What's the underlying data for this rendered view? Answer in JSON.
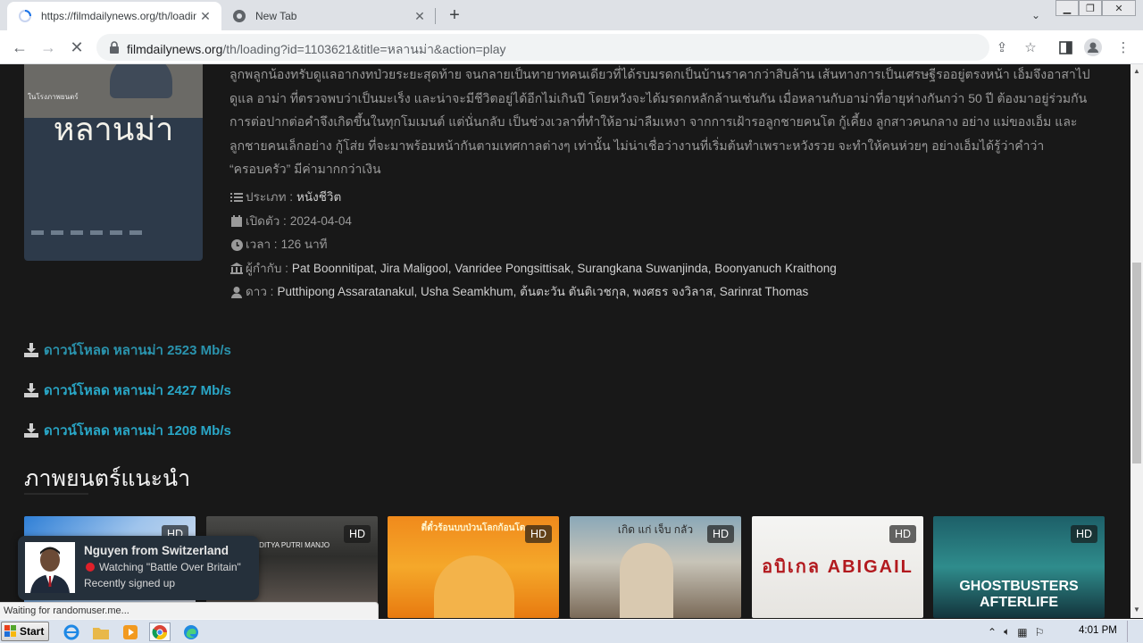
{
  "browser": {
    "tabs": [
      {
        "title": "https://filmdailynews.org/th/loading",
        "active": true,
        "loading": true
      },
      {
        "title": "New Tab",
        "active": false
      }
    ],
    "address": {
      "host": "filmdailynews.org",
      "path": "/th/loading?id=1103621&title=หลานม่า&action=play"
    },
    "status_text": "Waiting for randomuser.me..."
  },
  "movie": {
    "poster": {
      "title": "หลานม่า",
      "tagline": "ในโรงภาพยนตร์"
    },
    "synopsis": "ลูกพลูกน้องทรับดูแลอากงทป่วยระยะสุดท้าย จนกลายเป็นทายาทคนเดียวที่ได้รบมรดกเป็นบ้านราคากว่าสิบล้าน เส้นทางการเป็นเศรษฐีรออยู่ตรงหน้า เอ็มจึงอาสาไปดูแล อาม่า ที่ตรวจพบว่าเป็นมะเร็ง และน่าจะมีชีวิตอยู่ได้อีกไม่เกินปี โดยหวังจะได้มรดกหลักล้านเช่นกัน เมื่อหลานกับอาม่าที่อายุห่างกันกว่า 50 ปี ต้องมาอยู่ร่วมกัน การต่อปากต่อคำจึงเกิดขึ้นในทุกโมเมนต์ แต่นั่นกลับ เป็นช่วงเวลาที่ทำให้อาม่าลืมเหงา จากการเฝ้ารอลูกชายคนโต กู้เคี้ยง ลูกสาวคนกลาง อย่าง แม่ของเอ็ม และลูกชายคนเล็กอย่าง กู้โส่ย ที่จะมาพร้อมหน้ากันตามเทศกาลต่างๆ เท่านั้น ไม่น่าเชื่อว่างานที่เริ่มต้นทำเพราะหวังรวย จะทำให้คนห่วยๆ อย่างเอ็มได้รู้ว่าคำว่า “ครอบครัว” มีค่ามากกว่าเงิน",
    "meta": [
      {
        "icon": "list-icon",
        "label": "ประเภท :",
        "value": "หนังชีวิต"
      },
      {
        "icon": "calendar-icon",
        "label": "เปิดตัว :",
        "value": "2024-04-04"
      },
      {
        "icon": "clock-icon",
        "label": "เวลา :",
        "value": "126 นาที"
      },
      {
        "icon": "bank-icon",
        "label": "ผู้กำกับ :",
        "value": "Pat Boonnitipat, Jira Maligool, Vanridee Pongsittisak, Surangkana Suwanjinda, Boonyanuch Kraithong"
      },
      {
        "icon": "user-icon",
        "label": "ดาว :",
        "value": "Putthipong Assaratanakul, Usha Seamkhum, ต้นตะวัน ตันติเวชกุล, พงศธร จงวิลาส, Sarinrat Thomas"
      }
    ],
    "downloads": [
      {
        "label": "ดาวน์โหลด หลานม่า 2523 Mb/s"
      },
      {
        "label": "ดาวน์โหลด หลานม่า 2427 Mb/s"
      },
      {
        "label": "ดาวน์โหลด หลานม่า 1208 Mb/s"
      }
    ]
  },
  "recommended": {
    "heading": "ภาพยนตร์แนะนำ",
    "badge": "HD",
    "cards": [
      {
        "name": "movie-card-1",
        "text": ""
      },
      {
        "name": "movie-card-2",
        "text": "ADITYA  PUTRI MANJO"
      },
      {
        "name": "movie-card-3",
        "text": "ตี๋ตั๋วร้อนบบป่วนโลกก้อนโต"
      },
      {
        "name": "movie-card-4",
        "text": "เกิด แก่ เจ็บ กลัว"
      },
      {
        "name": "movie-card-5",
        "text": "อบิเกล ABIGAIL"
      },
      {
        "name": "movie-card-6",
        "text": "GHOSTBUSTERS AFTERLIFE"
      }
    ]
  },
  "toast": {
    "name": "Nguyen from Switzerland",
    "activity": "Watching \"Battle Over Britain\"",
    "subtext": "Recently signed up"
  },
  "taskbar": {
    "start_label": "Start",
    "clock": "4:01 PM"
  },
  "colors": {
    "page_bg": "#181818",
    "link": "#29a6c6",
    "toast_bg": "#25303b"
  }
}
